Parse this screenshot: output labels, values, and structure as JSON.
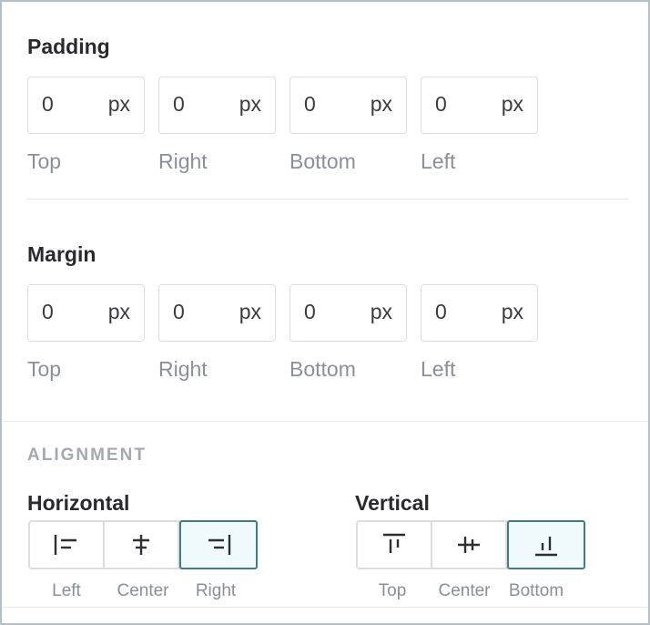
{
  "padding": {
    "title": "Padding",
    "fields": [
      {
        "value": "0",
        "unit": "px",
        "label": "Top"
      },
      {
        "value": "0",
        "unit": "px",
        "label": "Right"
      },
      {
        "value": "0",
        "unit": "px",
        "label": "Bottom"
      },
      {
        "value": "0",
        "unit": "px",
        "label": "Left"
      }
    ]
  },
  "margin": {
    "title": "Margin",
    "fields": [
      {
        "value": "0",
        "unit": "px",
        "label": "Top"
      },
      {
        "value": "0",
        "unit": "px",
        "label": "Right"
      },
      {
        "value": "0",
        "unit": "px",
        "label": "Bottom"
      },
      {
        "value": "0",
        "unit": "px",
        "label": "Left"
      }
    ]
  },
  "alignment": {
    "caption": "ALIGNMENT",
    "horizontal": {
      "title": "Horizontal",
      "selected": "Right",
      "options": [
        {
          "label": "Left",
          "icon": "align-left-icon"
        },
        {
          "label": "Center",
          "icon": "align-center-horizontal-icon"
        },
        {
          "label": "Right",
          "icon": "align-right-icon"
        }
      ]
    },
    "vertical": {
      "title": "Vertical",
      "selected": "Bottom",
      "options": [
        {
          "label": "Top",
          "icon": "align-top-icon"
        },
        {
          "label": "Center",
          "icon": "align-center-vertical-icon"
        },
        {
          "label": "Bottom",
          "icon": "align-bottom-icon"
        }
      ]
    }
  },
  "colors": {
    "accent": "#3f7d7e",
    "accent_bg": "#f0f9fb",
    "border": "#dcdde0",
    "label": "#8a8f98"
  }
}
